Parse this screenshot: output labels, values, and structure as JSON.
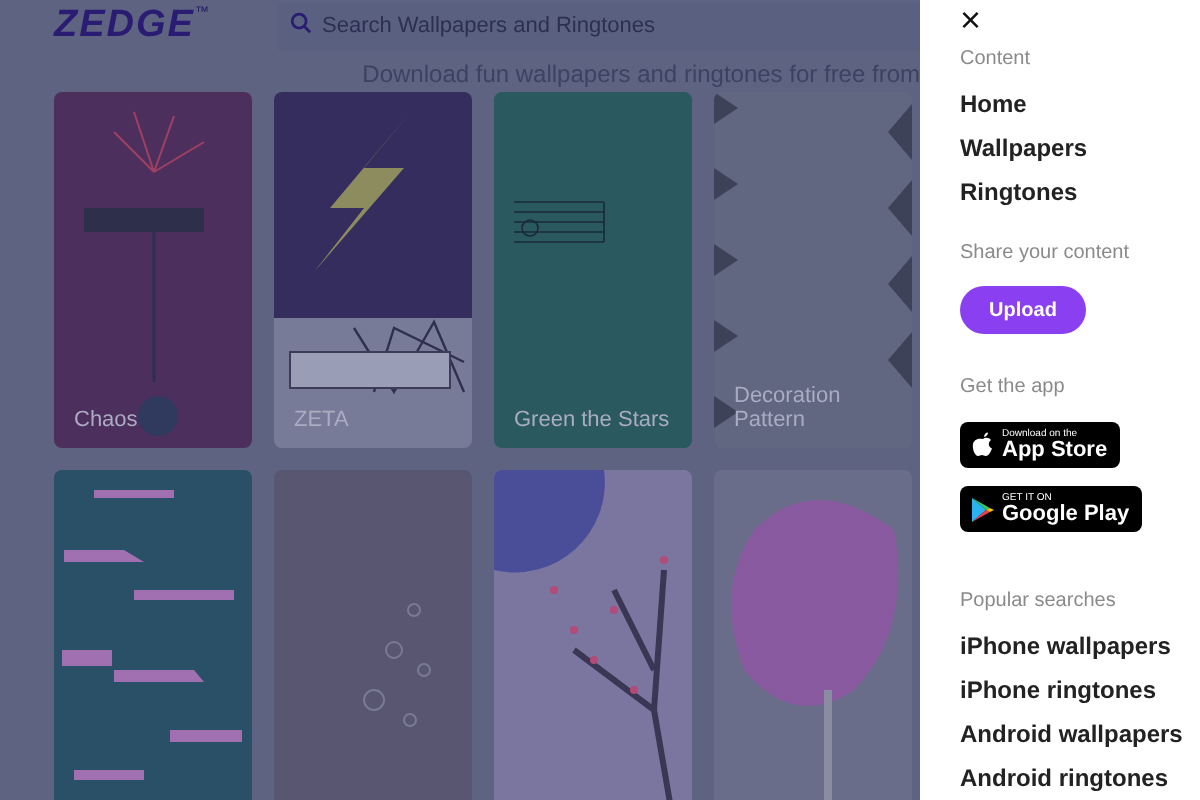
{
  "header": {
    "logo": "ZEDGE",
    "logo_mark": "™",
    "search": {
      "placeholder": "Search Wallpapers and Ringtones"
    }
  },
  "tagline": "Download fun wallpapers and ringtones for free from",
  "wallpapers": [
    {
      "kind": "equation",
      "title": "Chaos"
    },
    {
      "kind": "lightning",
      "title": "ZETA"
    },
    {
      "kind": "music",
      "title": "Green the Stars"
    },
    {
      "kind": "pattern",
      "title": "Decoration Pattern"
    },
    {
      "kind": "cracks"
    },
    {
      "kind": "bubbles"
    },
    {
      "kind": "blossom"
    },
    {
      "kind": "tree"
    }
  ],
  "menu": {
    "close": "×",
    "content": {
      "heading": "Content",
      "items": [
        "Home",
        "Wallpapers",
        "Ringtones"
      ]
    },
    "share": {
      "heading": "Share your content",
      "button": "Upload"
    },
    "app": {
      "heading": "Get the app",
      "badges": [
        {
          "kind": "apple",
          "small": "Download on the",
          "big": "App Store"
        },
        {
          "kind": "google",
          "small": "GET IT ON",
          "big": "Google Play"
        }
      ]
    },
    "popular": {
      "heading": "Popular searches",
      "items": [
        "iPhone wallpapers",
        "iPhone ringtones",
        "Android wallpapers",
        "Android ringtones"
      ]
    }
  }
}
